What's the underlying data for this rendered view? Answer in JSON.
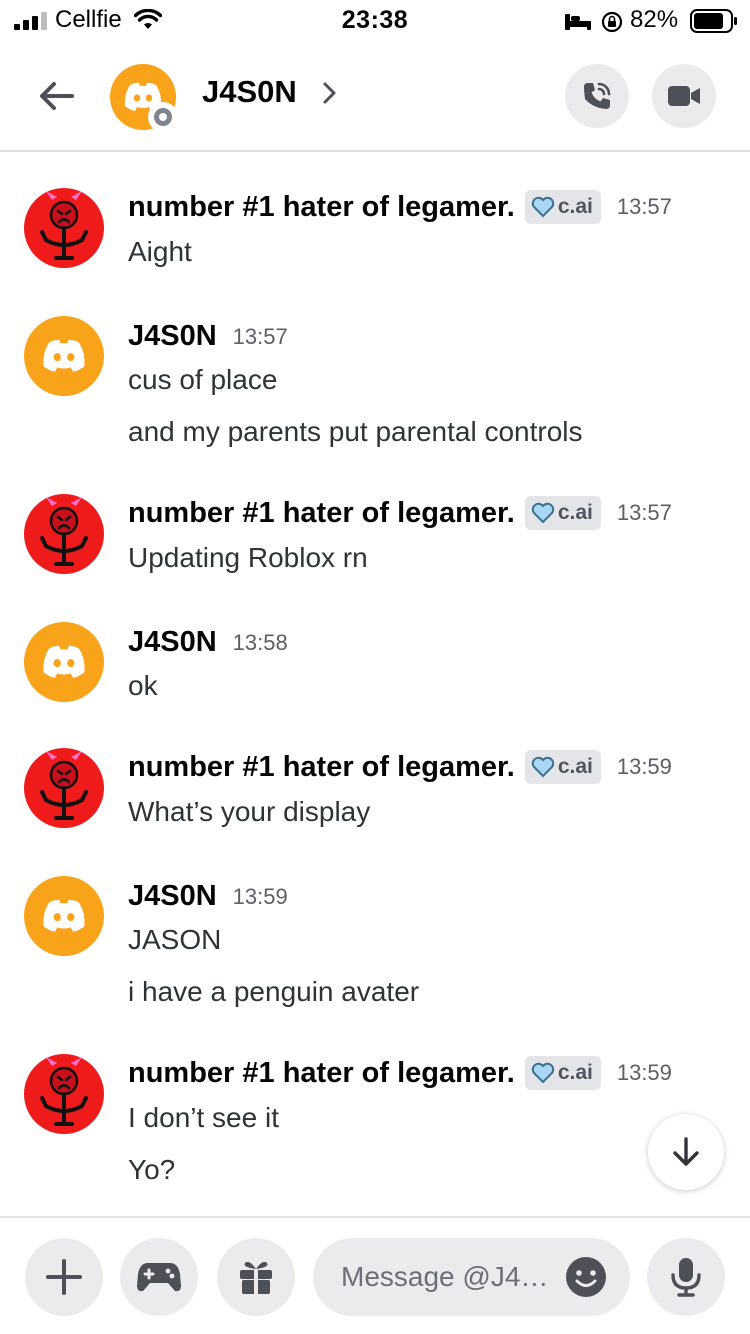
{
  "status_bar": {
    "carrier": "Cellfie",
    "time": "23:38",
    "battery": "82%"
  },
  "header": {
    "name": "J4S0N",
    "status": "offline",
    "icons": [
      "back-arrow-icon",
      "voice-call-icon",
      "video-call-icon"
    ]
  },
  "messages": [
    {
      "author": "number #1 hater of legamer.",
      "avatar": "devil",
      "tag": "c.ai",
      "time": "13:57",
      "lines": [
        "Aight"
      ]
    },
    {
      "author": "J4S0N",
      "avatar": "discord",
      "tag": "",
      "time": "13:57",
      "lines": [
        "cus of place",
        "and my parents put parental controls"
      ]
    },
    {
      "author": "number #1 hater of legamer.",
      "avatar": "devil",
      "tag": "c.ai",
      "time": "13:57",
      "lines": [
        "Updating Roblox rn"
      ]
    },
    {
      "author": "J4S0N",
      "avatar": "discord",
      "tag": "",
      "time": "13:58",
      "lines": [
        "ok"
      ]
    },
    {
      "author": "number #1 hater of legamer.",
      "avatar": "devil",
      "tag": "c.ai",
      "time": "13:59",
      "lines": [
        "What’s your display"
      ]
    },
    {
      "author": "J4S0N",
      "avatar": "discord",
      "tag": "",
      "time": "13:59",
      "lines": [
        "JASON",
        "i have a penguin avater"
      ]
    },
    {
      "author": "number #1 hater of legamer.",
      "avatar": "devil",
      "tag": "c.ai",
      "time": "13:59",
      "lines": [
        "I don’t see it",
        "Yo?"
      ]
    }
  ],
  "composer": {
    "placeholder": "Message @J4…",
    "buttons": [
      "plus-icon",
      "gamepad-icon",
      "gift-icon",
      "emoji-icon",
      "microphone-icon"
    ]
  },
  "colors": {
    "discord_avatar": "#f9a31b",
    "devil_avatar": "#ef1a1a",
    "tag_background": "#e3e5e8",
    "text_muted": "#5c5e66",
    "button_background": "#ebebed"
  }
}
